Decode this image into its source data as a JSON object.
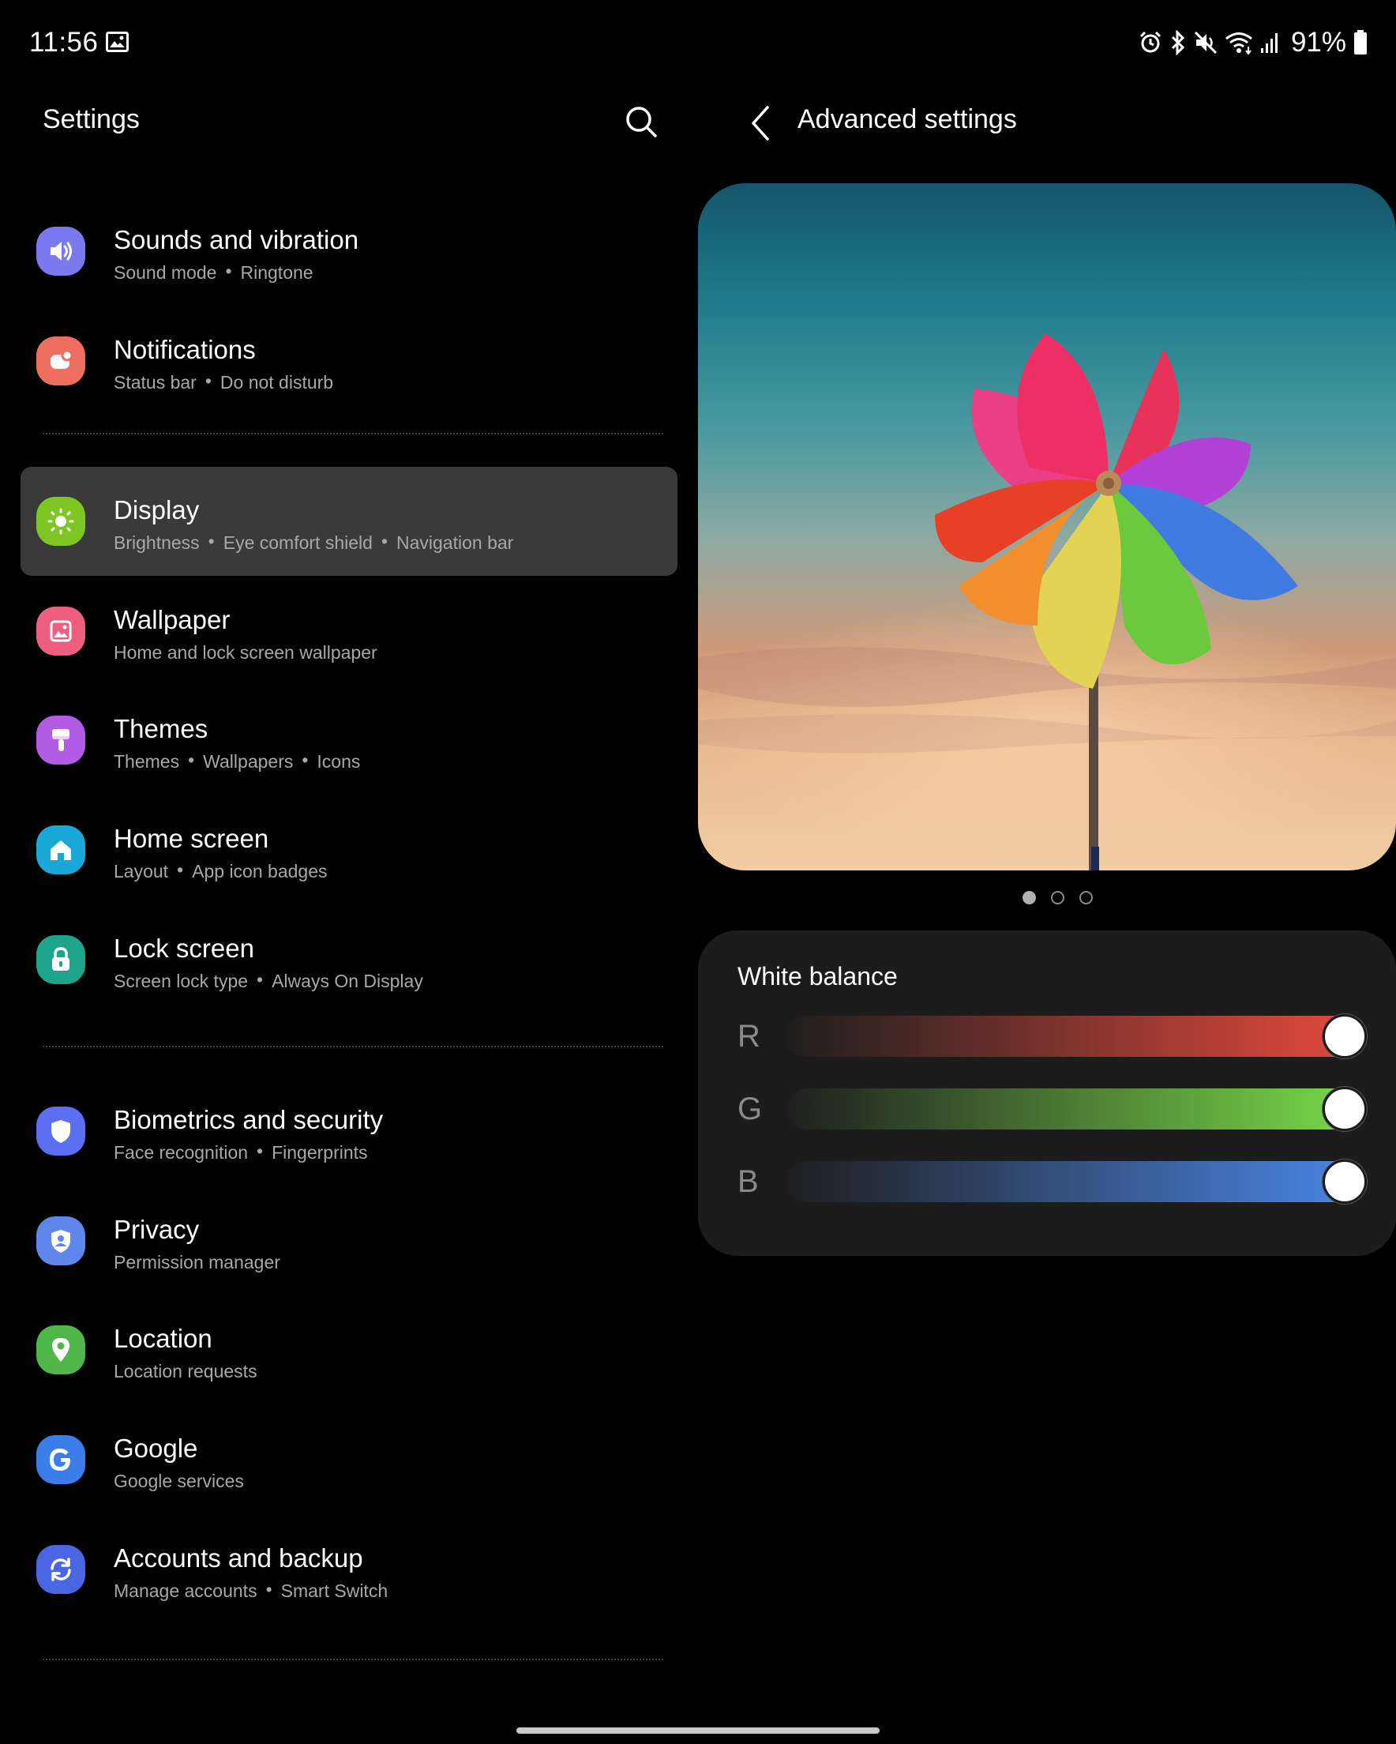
{
  "status_bar": {
    "time": "11:56",
    "battery": "91%"
  },
  "left_panel": {
    "title": "Settings",
    "items": [
      {
        "title": "Sounds and vibration",
        "subs": [
          "Sound mode",
          "Ringtone"
        ],
        "icon": "speaker-icon",
        "color": "#7b79f0"
      },
      {
        "title": "Notifications",
        "subs": [
          "Status bar",
          "Do not disturb"
        ],
        "icon": "notification-icon",
        "color": "#ee6e5f"
      },
      {
        "title": "Display",
        "subs": [
          "Brightness",
          "Eye comfort shield",
          "Navigation bar"
        ],
        "icon": "sun-icon",
        "color": "#7dc623",
        "active": true
      },
      {
        "title": "Wallpaper",
        "subs": [
          "Home and lock screen wallpaper"
        ],
        "icon": "picture-icon",
        "color": "#ee5e7f"
      },
      {
        "title": "Themes",
        "subs": [
          "Themes",
          "Wallpapers",
          "Icons"
        ],
        "icon": "paintbrush-icon",
        "color": "#b25be4"
      },
      {
        "title": "Home screen",
        "subs": [
          "Layout",
          "App icon badges"
        ],
        "icon": "house-icon",
        "color": "#1aa8d8"
      },
      {
        "title": "Lock screen",
        "subs": [
          "Screen lock type",
          "Always On Display"
        ],
        "icon": "lock-icon",
        "color": "#1ea48b"
      },
      {
        "title": "Biometrics and security",
        "subs": [
          "Face recognition",
          "Fingerprints"
        ],
        "icon": "shield-icon",
        "color": "#5c6ef2"
      },
      {
        "title": "Privacy",
        "subs": [
          "Permission manager"
        ],
        "icon": "privacy-shield-icon",
        "color": "#5f86ea"
      },
      {
        "title": "Location",
        "subs": [
          "Location requests"
        ],
        "icon": "location-pin-icon",
        "color": "#4fb64a"
      },
      {
        "title": "Google",
        "subs": [
          "Google services"
        ],
        "icon": "google-icon",
        "color": "#3b7ee9"
      },
      {
        "title": "Accounts and backup",
        "subs": [
          "Manage accounts",
          "Smart Switch"
        ],
        "icon": "sync-icon",
        "color": "#4a66e2"
      }
    ]
  },
  "right_panel": {
    "title": "Advanced settings",
    "pager": {
      "count": 3,
      "current": 1
    },
    "white_balance": {
      "title": "White balance",
      "channels": [
        {
          "letter": "R",
          "level": 1.0,
          "color": "#e34a3c"
        },
        {
          "letter": "G",
          "level": 1.0,
          "color": "#78d84a"
        },
        {
          "letter": "B",
          "level": 1.0,
          "color": "#4a86e4"
        }
      ]
    }
  }
}
